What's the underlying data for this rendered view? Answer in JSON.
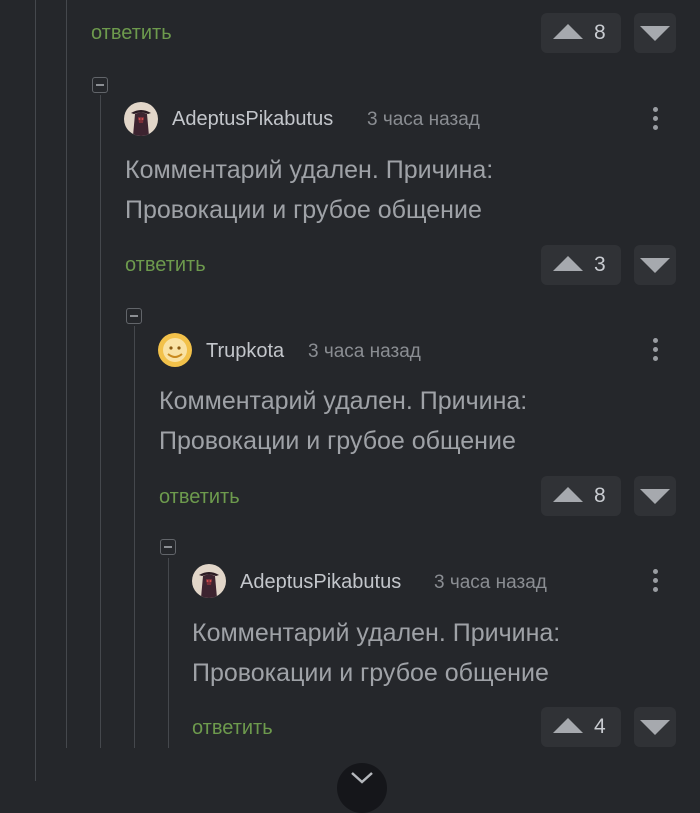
{
  "comments": [
    {
      "reply_label": "ответить",
      "rating": "8"
    },
    {
      "author": "AdeptusPikabutus",
      "time": "3 часа назад",
      "avatar": "hooded-figure-avatar",
      "text_line1": "Комментарий удален. Причина:",
      "text_line2": "Провокации и грубое общение",
      "reply_label": "ответить",
      "rating": "3"
    },
    {
      "author": "Trupkota",
      "time": "3 часа назад",
      "avatar": "yellow-face-avatar",
      "text_line1": "Комментарий удален. Причина:",
      "text_line2": "Провокации и грубое общение",
      "reply_label": "ответить",
      "rating": "8"
    },
    {
      "author": "AdeptusPikabutus",
      "time": "3 часа назад",
      "avatar": "hooded-figure-avatar",
      "text_line1": "Комментарий удален. Причина:",
      "text_line2": "Провокации и грубое общение",
      "reply_label": "ответить",
      "rating": "4"
    }
  ],
  "icons": {
    "upvote": "triangle-up-icon",
    "downvote": "triangle-down-icon",
    "more": "vertical-dots-icon",
    "collapse": "minus-square-icon",
    "scroll": "chevron-down-icon"
  },
  "colors": {
    "background": "#25272b",
    "reply_link": "#6d9a4d",
    "vote_box": "#303236"
  }
}
